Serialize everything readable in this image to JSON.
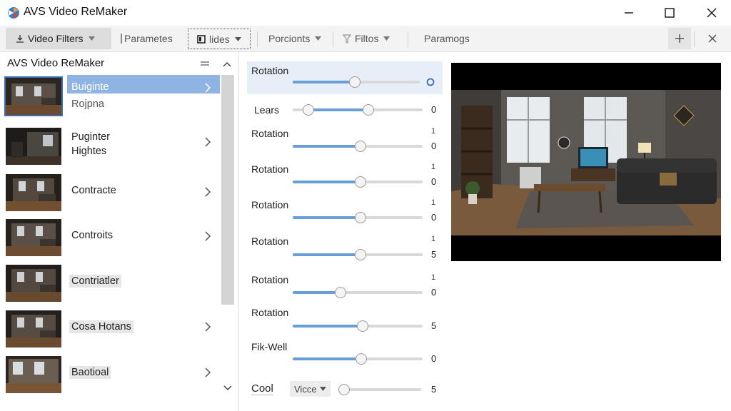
{
  "window": {
    "title": "AVS Video ReMaker",
    "controls": [
      "minimize-icon",
      "maximize-icon",
      "close-icon"
    ]
  },
  "toolbar": {
    "items": [
      {
        "label": "Video Filters",
        "icon": "filter-icon",
        "dropdown": true,
        "active": true
      },
      {
        "label": "Parametes",
        "icon": "bar-icon",
        "dropdown": false
      },
      {
        "label": "lides",
        "icon": "square-icon",
        "dropdown": true,
        "focused": true
      },
      {
        "label": "Porcionts",
        "icon": "",
        "dropdown": true
      },
      {
        "label": "Filtos",
        "icon": "funnel-icon",
        "dropdown": true
      },
      {
        "label": "Paramogs",
        "icon": "",
        "dropdown": false
      }
    ],
    "right_buttons": [
      "plus-icon",
      "close-icon"
    ]
  },
  "left_panel": {
    "title": "AVS Video ReMaker",
    "items": [
      {
        "label_line1": "Buiginte",
        "label_line2": "Rojpna",
        "selected": true,
        "chevron": true
      },
      {
        "label_line1": "Puginter",
        "label_line2": "Hightes",
        "selected": false,
        "chevron": true
      },
      {
        "label_line1": "Contracte",
        "label_line2": "",
        "selected": false,
        "chevron": true
      },
      {
        "label_line1": "Controits",
        "label_line2": "",
        "selected": false,
        "chevron": true
      },
      {
        "label_line1": "Contriatler",
        "label_line2": "",
        "selected": false,
        "chevron": false,
        "highlighted": true
      },
      {
        "label_line1": "Cosa Hotans",
        "label_line2": "",
        "selected": false,
        "chevron": true,
        "highlighted": true
      },
      {
        "label_line1": "Baotioal",
        "label_line2": "",
        "selected": false,
        "chevron": true,
        "highlighted": true
      }
    ]
  },
  "parameters": {
    "rows": [
      {
        "label": "Rotation",
        "value": "",
        "level": 0.49,
        "end_icon": "circle-icon"
      },
      {
        "label": "Lears",
        "value": "0",
        "range_low": 0.12,
        "range_high": 0.58
      },
      {
        "label": "Rotation",
        "small": "1",
        "value": "0",
        "level": 0.52
      },
      {
        "label": "Rotation",
        "small": "1",
        "value": "0",
        "level": 0.52
      },
      {
        "label": "Rotation",
        "small": "1",
        "value": "0",
        "level": 0.52
      },
      {
        "label": "Rotation",
        "small": "1",
        "value": "5",
        "level": 0.52
      },
      {
        "label": "Rotation",
        "small": "1",
        "value": "0",
        "level": 0.37
      },
      {
        "label": "Rotation",
        "small": "",
        "value": "5",
        "level": 0.54
      },
      {
        "label": "Fik-Well",
        "value": "0",
        "level": 0.53
      }
    ],
    "bottom_row": {
      "label": "Cool",
      "dropdown": "Vicce",
      "value": "5",
      "level": 0.0
    }
  },
  "preview": {
    "scene": "living room with sofa, coffee table, windows, TV and bookshelf"
  },
  "colors": {
    "accent": "#6a9fd6",
    "selection": "#8fb4e3",
    "toolbar_bg": "#f3f3f3"
  }
}
